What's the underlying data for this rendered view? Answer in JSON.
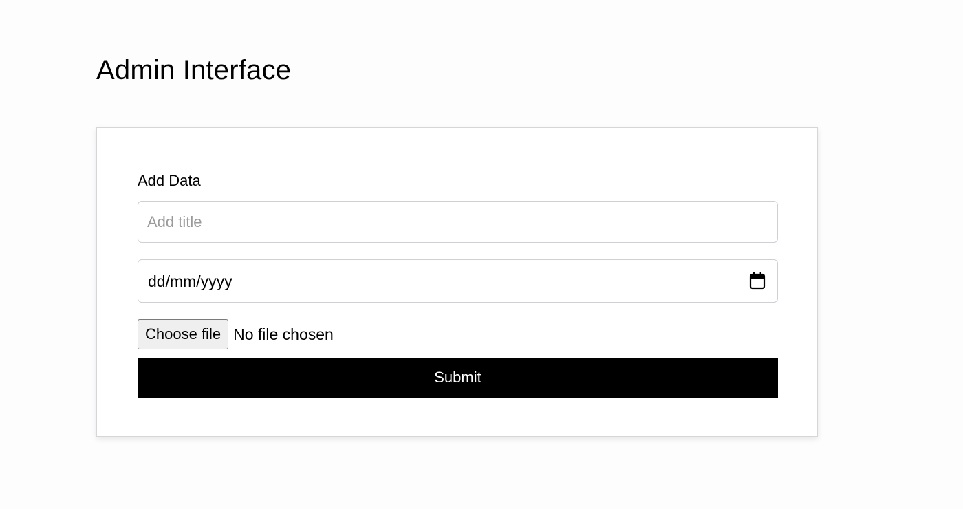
{
  "page": {
    "title": "Admin Interface"
  },
  "form": {
    "label": "Add Data",
    "title_input": {
      "value": "",
      "placeholder": "Add title"
    },
    "date_input": {
      "display": "dd/mm/yyyy",
      "icon": "calendar-icon"
    },
    "file_input": {
      "button_label": "Choose file",
      "status": "No file chosen"
    },
    "submit_label": "Submit"
  },
  "colors": {
    "background": "#fdfdfe",
    "card": "#ffffff",
    "submit_bg": "#000000",
    "submit_text": "#ffffff",
    "placeholder": "#9a9a9a"
  }
}
